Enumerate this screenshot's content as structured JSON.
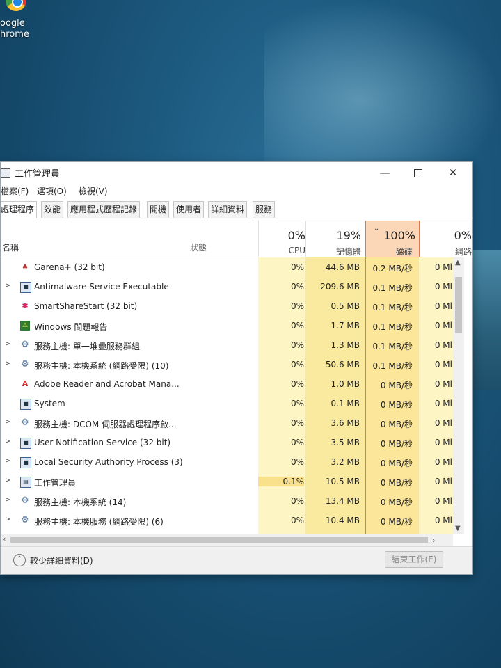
{
  "desktop": {
    "icon_line1": "oogle",
    "icon_line2": "hrome"
  },
  "window": {
    "title": "工作管理員"
  },
  "menu": [
    "檔案(F)",
    "選項(O)",
    "檢視(V)"
  ],
  "tabs": [
    "處理程序",
    "效能",
    "應用程式歷程記錄",
    "開機",
    "使用者",
    "詳細資料",
    "服務"
  ],
  "columns": {
    "name": "名稱",
    "status": "狀態",
    "cpu": {
      "pct": "0%",
      "label": "CPU"
    },
    "memory": {
      "pct": "19%",
      "label": "記憶體"
    },
    "disk": {
      "pct": "100%",
      "label": "磁碟"
    },
    "network": {
      "pct": "0%",
      "label": "網路"
    }
  },
  "processes": [
    {
      "name": "Garena+ (32 bit)",
      "cpu": "0%",
      "mem": "44.6 MB",
      "disk": "0.2 MB/秒",
      "net": "0 Ml",
      "expand": "",
      "icon": "garena-icon"
    },
    {
      "name": "Antimalware Service Executable",
      "cpu": "0%",
      "mem": "209.6 MB",
      "disk": "0.1 MB/秒",
      "net": "0 Ml",
      "expand": ">",
      "icon": "window-icon"
    },
    {
      "name": "SmartShareStart (32 bit)",
      "cpu": "0%",
      "mem": "0.5 MB",
      "disk": "0.1 MB/秒",
      "net": "0 Ml",
      "expand": "",
      "icon": "smartshare-icon"
    },
    {
      "name": "Windows 問題報告",
      "cpu": "0%",
      "mem": "1.7 MB",
      "disk": "0.1 MB/秒",
      "net": "0 Ml",
      "expand": "",
      "icon": "report-icon"
    },
    {
      "name": "服務主機: 單一堆疊服務群組",
      "cpu": "0%",
      "mem": "1.3 MB",
      "disk": "0.1 MB/秒",
      "net": "0 Ml",
      "expand": ">",
      "icon": "gear-icon"
    },
    {
      "name": "服務主機: 本機系統 (網路受限) (10)",
      "cpu": "0%",
      "mem": "50.6 MB",
      "disk": "0.1 MB/秒",
      "net": "0 Ml",
      "expand": ">",
      "icon": "gear-icon"
    },
    {
      "name": "Adobe Reader and Acrobat Mana...",
      "cpu": "0%",
      "mem": "1.0 MB",
      "disk": "0 MB/秒",
      "net": "0 Ml",
      "expand": "",
      "icon": "adobe-icon"
    },
    {
      "name": "System",
      "cpu": "0%",
      "mem": "0.1 MB",
      "disk": "0 MB/秒",
      "net": "0 Ml",
      "expand": "",
      "icon": "window-icon"
    },
    {
      "name": "服務主機: DCOM 伺服器處理程序啟...",
      "cpu": "0%",
      "mem": "3.6 MB",
      "disk": "0 MB/秒",
      "net": "0 Ml",
      "expand": ">",
      "icon": "gear-icon"
    },
    {
      "name": "User Notification Service (32 bit)",
      "cpu": "0%",
      "mem": "3.5 MB",
      "disk": "0 MB/秒",
      "net": "0 Ml",
      "expand": ">",
      "icon": "window-icon"
    },
    {
      "name": "Local Security Authority Process (3)",
      "cpu": "0%",
      "mem": "3.2 MB",
      "disk": "0 MB/秒",
      "net": "0 Ml",
      "expand": ">",
      "icon": "window-icon"
    },
    {
      "name": "工作管理員",
      "cpu": "0.1%",
      "mem": "10.5 MB",
      "disk": "0 MB/秒",
      "net": "0 Ml",
      "expand": ">",
      "icon": "taskmgr-icon"
    },
    {
      "name": "服務主機: 本機系統 (14)",
      "cpu": "0%",
      "mem": "13.4 MB",
      "disk": "0 MB/秒",
      "net": "0 Ml",
      "expand": ">",
      "icon": "gear-icon"
    },
    {
      "name": "服務主機: 本機服務 (網路受限) (6)",
      "cpu": "0%",
      "mem": "10.4 MB",
      "disk": "0 MB/秒",
      "net": "0 Ml",
      "expand": ">",
      "icon": "gear-icon"
    }
  ],
  "footer": {
    "fewer_details": "較少詳細資料(D)",
    "end_task": "結束工作(E)"
  }
}
